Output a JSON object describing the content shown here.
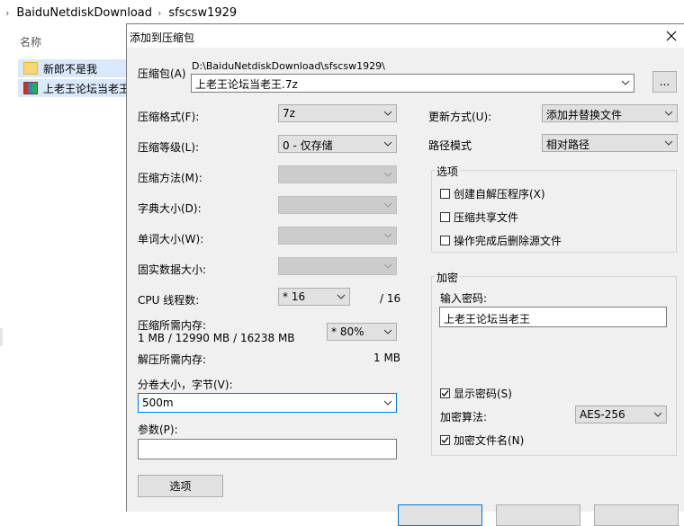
{
  "explorer": {
    "breadcrumb": [
      "BaiduNetdiskDownload",
      "sfscsw1929"
    ],
    "column_name": "名称",
    "files": [
      {
        "name": "新郎不是我",
        "type": "folder"
      },
      {
        "name": "上老王论坛当老王",
        "type": "archive"
      }
    ]
  },
  "dialog": {
    "title": "添加到压缩包",
    "archive_label": "压缩包(A)",
    "archive_path": "D:\\BaiduNetdiskDownload\\sfscsw1929\\",
    "archive_name": "上老王论坛当老王.7z",
    "browse_label": "...",
    "left": {
      "format_label": "压缩格式(F):",
      "format_value": "7z",
      "level_label": "压缩等级(L):",
      "level_value": "0 - 仅存储",
      "method_label": "压缩方法(M):",
      "dict_label": "字典大小(D):",
      "word_label": "单词大小(W):",
      "solid_label": "固实数据大小:",
      "threads_label": "CPU 线程数:",
      "threads_value": "* 16",
      "threads_total": "/ 16",
      "mem_comp_label": "压缩所需内存:",
      "mem_comp_value": "1 MB / 12990 MB / 16238 MB",
      "mem_percent": "* 80%",
      "mem_decomp_label": "解压所需内存:",
      "mem_decomp_value": "1 MB",
      "volume_label": "分卷大小，字节(V):",
      "volume_value": "500m",
      "params_label": "参数(P):",
      "params_value": "",
      "options_button": "选项"
    },
    "right": {
      "update_label": "更新方式(U):",
      "update_value": "添加并替换文件",
      "path_label": "路径模式",
      "path_value": "相对路径",
      "options_group": "选项",
      "opt_sfx": "创建自解压程序(X)",
      "opt_shared": "压缩共享文件",
      "opt_delete": "操作完成后删除源文件",
      "encrypt_group": "加密",
      "password_label": "输入密码:",
      "password_value": "上老王论坛当老王",
      "show_password": "显示密码(S)",
      "algo_label": "加密算法:",
      "algo_value": "AES-256",
      "encrypt_names": "加密文件名(N)"
    }
  }
}
